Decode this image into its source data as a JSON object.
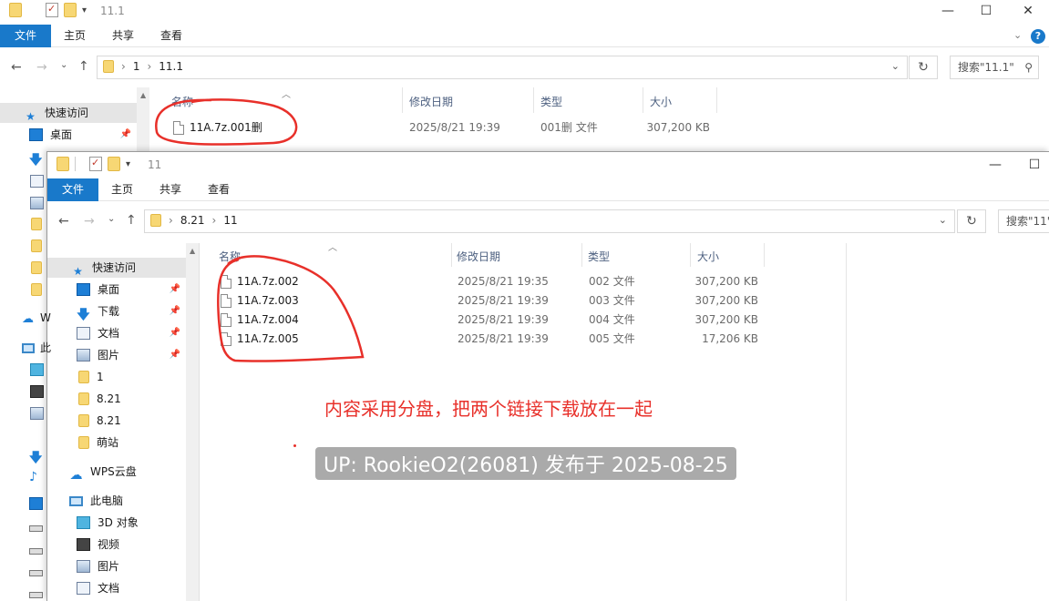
{
  "back_window": {
    "title": "11.1",
    "ribbon_tabs": [
      "文件",
      "主页",
      "共享",
      "查看"
    ],
    "address": [
      "1",
      "11.1"
    ],
    "search_placeholder": "搜索\"11.1\"",
    "columns": [
      "名称",
      "修改日期",
      "类型",
      "大小"
    ],
    "files": [
      {
        "name": "11A.7z.001删",
        "date": "2025/8/21 19:39",
        "type": "001删 文件",
        "size": "307,200 KB"
      }
    ],
    "sidebar": [
      {
        "label": "快速访问",
        "icon": "star-icon"
      },
      {
        "label": "桌面",
        "icon": "desktop-icon",
        "pinned": true
      }
    ]
  },
  "front_window": {
    "title": "11",
    "ribbon_tabs": [
      "文件",
      "主页",
      "共享",
      "查看"
    ],
    "address": [
      "8.21",
      "11"
    ],
    "search_placeholder": "搜索\"11\"",
    "columns": [
      "名称",
      "修改日期",
      "类型",
      "大小"
    ],
    "files": [
      {
        "name": "11A.7z.002",
        "date": "2025/8/21 19:35",
        "type": "002 文件",
        "size": "307,200 KB"
      },
      {
        "name": "11A.7z.003",
        "date": "2025/8/21 19:39",
        "type": "003 文件",
        "size": "307,200 KB"
      },
      {
        "name": "11A.7z.004",
        "date": "2025/8/21 19:39",
        "type": "004 文件",
        "size": "307,200 KB"
      },
      {
        "name": "11A.7z.005",
        "date": "2025/8/21 19:39",
        "type": "005 文件",
        "size": "17,206 KB"
      }
    ],
    "sidebar": [
      {
        "label": "快速访问",
        "icon": "star-icon"
      },
      {
        "label": "桌面",
        "icon": "desktop-icon",
        "pinned": true
      },
      {
        "label": "下载",
        "icon": "download-icon",
        "pinned": true
      },
      {
        "label": "文档",
        "icon": "document-icon",
        "pinned": true
      },
      {
        "label": "图片",
        "icon": "picture-icon",
        "pinned": true
      },
      {
        "label": "1",
        "icon": "folder-icon"
      },
      {
        "label": "8.21",
        "icon": "folder-icon"
      },
      {
        "label": "8.21",
        "icon": "folder-icon"
      },
      {
        "label": "萌站",
        "icon": "folder-icon"
      },
      {
        "label": "WPS云盘",
        "icon": "cloud-icon"
      },
      {
        "label": "此电脑",
        "icon": "computer-icon"
      },
      {
        "label": "3D 对象",
        "icon": "3d-objects-icon"
      },
      {
        "label": "视频",
        "icon": "video-icon"
      },
      {
        "label": "图片",
        "icon": "picture-icon"
      },
      {
        "label": "文档",
        "icon": "document-icon"
      }
    ],
    "partial_labels": {
      "wps_clip": "W",
      "pc_clip": "此"
    }
  },
  "annotation": {
    "note": "内容采用分盘，把两个链接下载放在一起",
    "uploader_badge": "UP: RookieO2(26081) 发布于 2025-08-25"
  },
  "colors": {
    "accent": "#1979ca",
    "annotation_red": "#e8302a",
    "selection": "#e5e5e5"
  }
}
